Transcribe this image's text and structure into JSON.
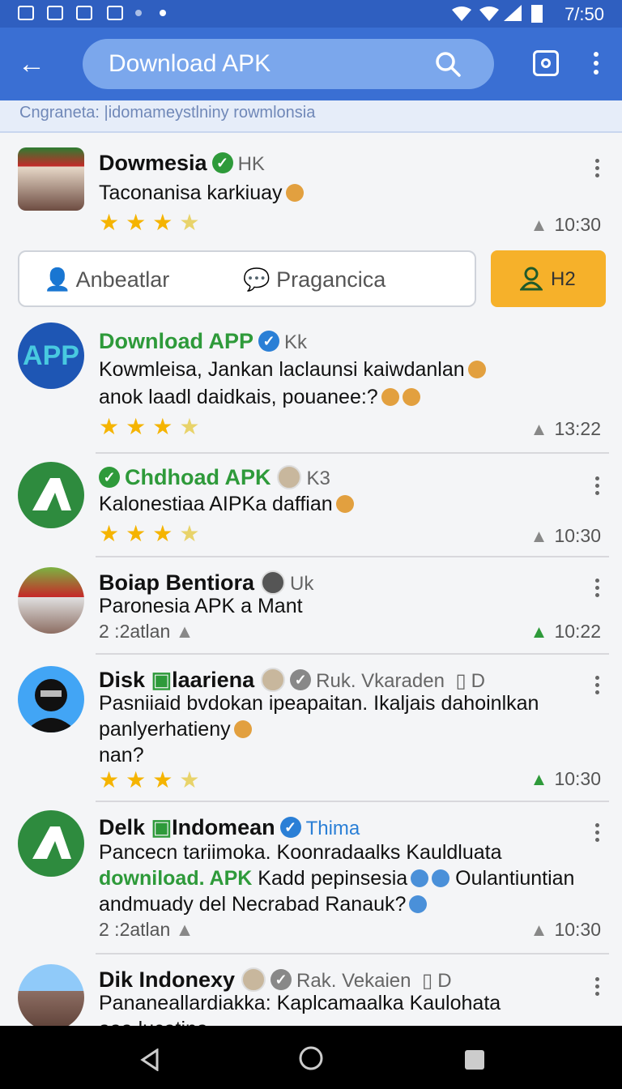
{
  "status_bar": {
    "time": "7/:50"
  },
  "app_bar": {
    "search_text": "Download APK"
  },
  "subheader": {
    "text": "Cngraneta: |idomameystlniny rowmlonsia"
  },
  "tabs": {
    "tab1": "Anbeatlar",
    "tab2": "Pragancica",
    "orange_label": "H2"
  },
  "posts": [
    {
      "name": "Dowmesia",
      "tag": "HK",
      "line1": "Taconanisa karkiuay",
      "time": "10:30",
      "rating": 4
    },
    {
      "name": "Download APP",
      "tag": "Kk",
      "line1": "Kowmleisa, Jankan laclaunsi kaiwdanlan",
      "line2": "anok laadl daidkais, pouanee:?",
      "time": "13:22",
      "rating": 4,
      "avatar_text": "APP"
    },
    {
      "name": "Chdhoad APK",
      "tag": "K3",
      "line1": "Kalonestiaa AIPKa daffian",
      "time": "10:30",
      "rating": 4
    },
    {
      "name": "Boiap Bentiora",
      "tag": "Uk",
      "line1": "Paronesia APK a Mant",
      "meta": "2 :2atlan",
      "time": "10:22"
    },
    {
      "name": "Disk",
      "name2": "laariena",
      "tag": "Ruk. Vkaraden",
      "tag2": "D",
      "line1": "Pasniiaid bvdokan ipeapaitan. Ikaljais dahoinlkan",
      "line2": "panlyerhatieny",
      "line3": "nan?",
      "time": "10:30",
      "rating": 4
    },
    {
      "name": "Delk",
      "name2": "Indomean",
      "tag": "Thima",
      "line1": "Pancecn tariimoka. Koonradaalks Kauldluata",
      "line2_hl": "downiload. APK",
      "line2": "Kadd pepinsesia",
      "line2_end": "Oulantiuntian",
      "line3": "andmuady del Necrabad Ranauk?",
      "meta": "2 :2atlan",
      "time": "10:30"
    },
    {
      "name": "Dik Indonexy",
      "tag": "Rak. Vekaien",
      "tag2": "D",
      "line1": "Pananeallardiakka: Kaplcamaalka Kaulohata",
      "line2": "aaa lucatina"
    }
  ]
}
